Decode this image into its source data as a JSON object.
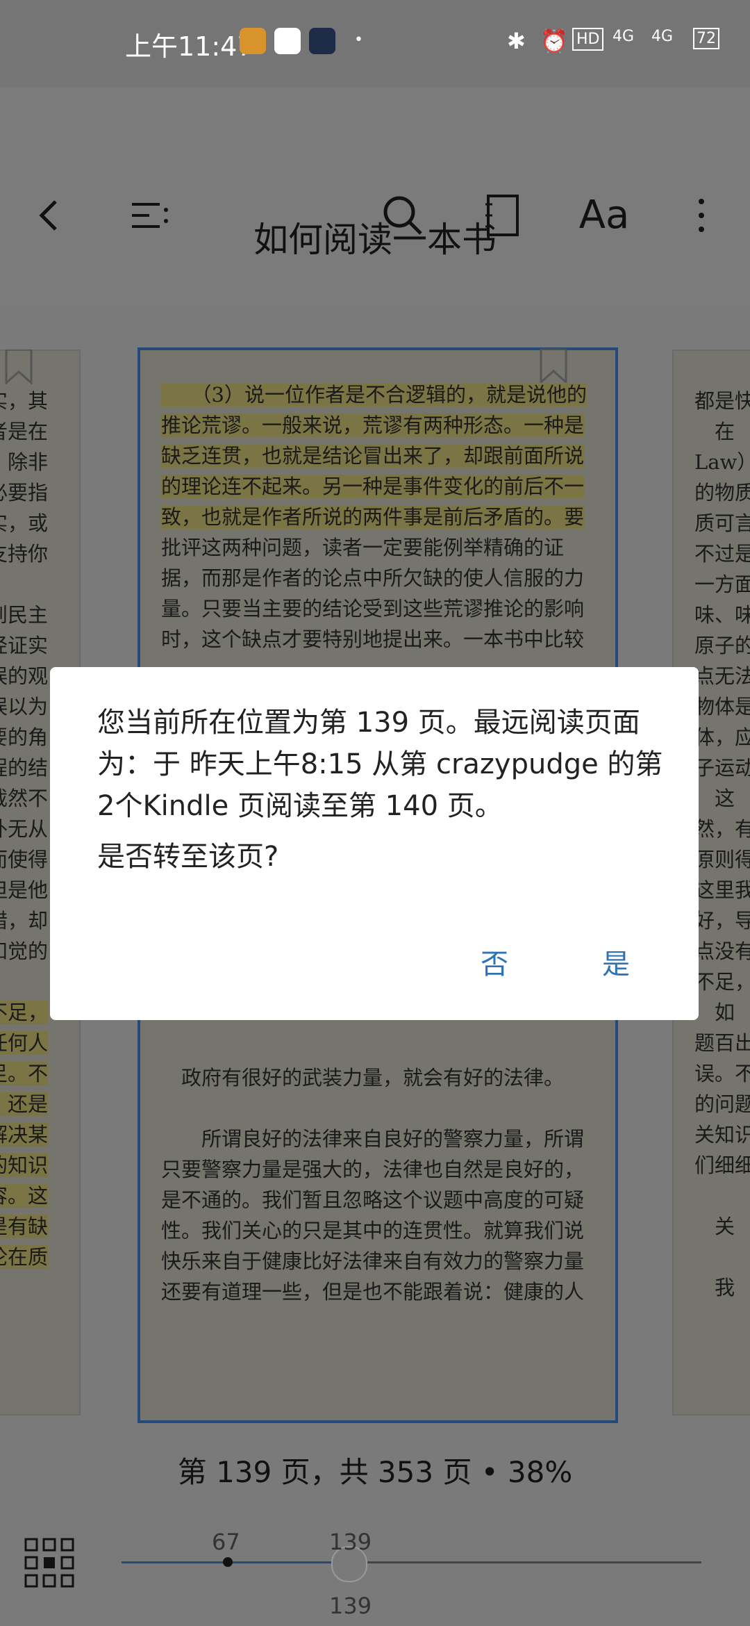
{
  "status": {
    "time": "上午11:47",
    "right_icons": [
      "bluetooth-icon",
      "alarm-icon",
      "HD",
      "4G",
      "4G"
    ],
    "battery": "72"
  },
  "book": {
    "title": "如何阅读一本书"
  },
  "pages": {
    "left_lines": [
      "实，其",
      "者是在",
      "，除非",
      "必要指",
      "实，或",
      "支持你",
      "",
      "到民主",
      "经证实",
      "误的观",
      "误以为",
      "要的角",
      "程的结",
      "截然不",
      "外无从",
      "而使得",
      "但是他",
      "错，却",
      "知觉的",
      "",
      "不足，",
      "任何人",
      "足。不",
      "，还是",
      "解决某",
      "的知识",
      "容。这",
      "是有缺",
      "论在质"
    ],
    "center_top": [
      "　　（3）说一位作者是不合逻辑的，就是说他的",
      "推论荒谬。一般来说，荒谬有两种形态。一种是",
      "缺乏连贯，也就是结论冒出来了，却跟前面所说",
      "的理论连不起来。另一种是事件变化的前后不一",
      "致，也就是作者所说的两件事是前后矛盾的。要",
      "批评这两种问题，读者一定要能例举精确的证",
      "据，而那是作者的论点中所欠缺的使人信服的力",
      "量。只要当主要的结论受到这些荒谬推论的影响",
      "时，这个缺点才要特别地提出来。一本书中比较"
    ],
    "center_bottom": [
      "　政府有很好的武装力量，就会有好的法律。",
      "",
      "　　所谓良好的法律来自良好的警察力量，所谓",
      "只要警察力量是强大的，法律也自然是良好的，",
      "是不通的。我们暂且忽略这个议题中高度的可疑",
      "性。我们关心的只是其中的连贯性。就算我们说",
      "快乐来自于健康比好法律来自有效力的警察力量",
      "还要有道理一些，但是也不能跟着说：健康的人"
    ],
    "right_lines": [
      "都是快",
      "　在",
      "Law）",
      "的物质",
      "质可言",
      "不过是",
      "一方面",
      "味、味",
      "原子的",
      "点无法",
      "物体是",
      "体，应",
      "子运动",
      "　这",
      "然，有",
      "原则得",
      "这里我",
      "好，导",
      "点没有",
      "不足，",
      "　如",
      "题百出",
      "误。不",
      "的问题",
      "关知识",
      "们细细",
      "",
      "　关",
      "",
      "　我"
    ]
  },
  "dialog": {
    "message": "您当前所在位置为第 139 页。最远阅读页面为：于 昨天上午8:15 从第 crazypudge 的第2个Kindle 页阅读至第 140 页。",
    "question": "是否转至该页?",
    "no": "否",
    "yes": "是"
  },
  "footer": {
    "page_info": "第 139 页，共 353 页 • 38%",
    "furthest_label": "67",
    "current_label": "139",
    "current_label_below": "139",
    "progress_fraction": 0.38
  },
  "colors": {
    "accent": "#2f73b3",
    "highlight": "#ece36b",
    "scrim": "#7a7a7a"
  }
}
